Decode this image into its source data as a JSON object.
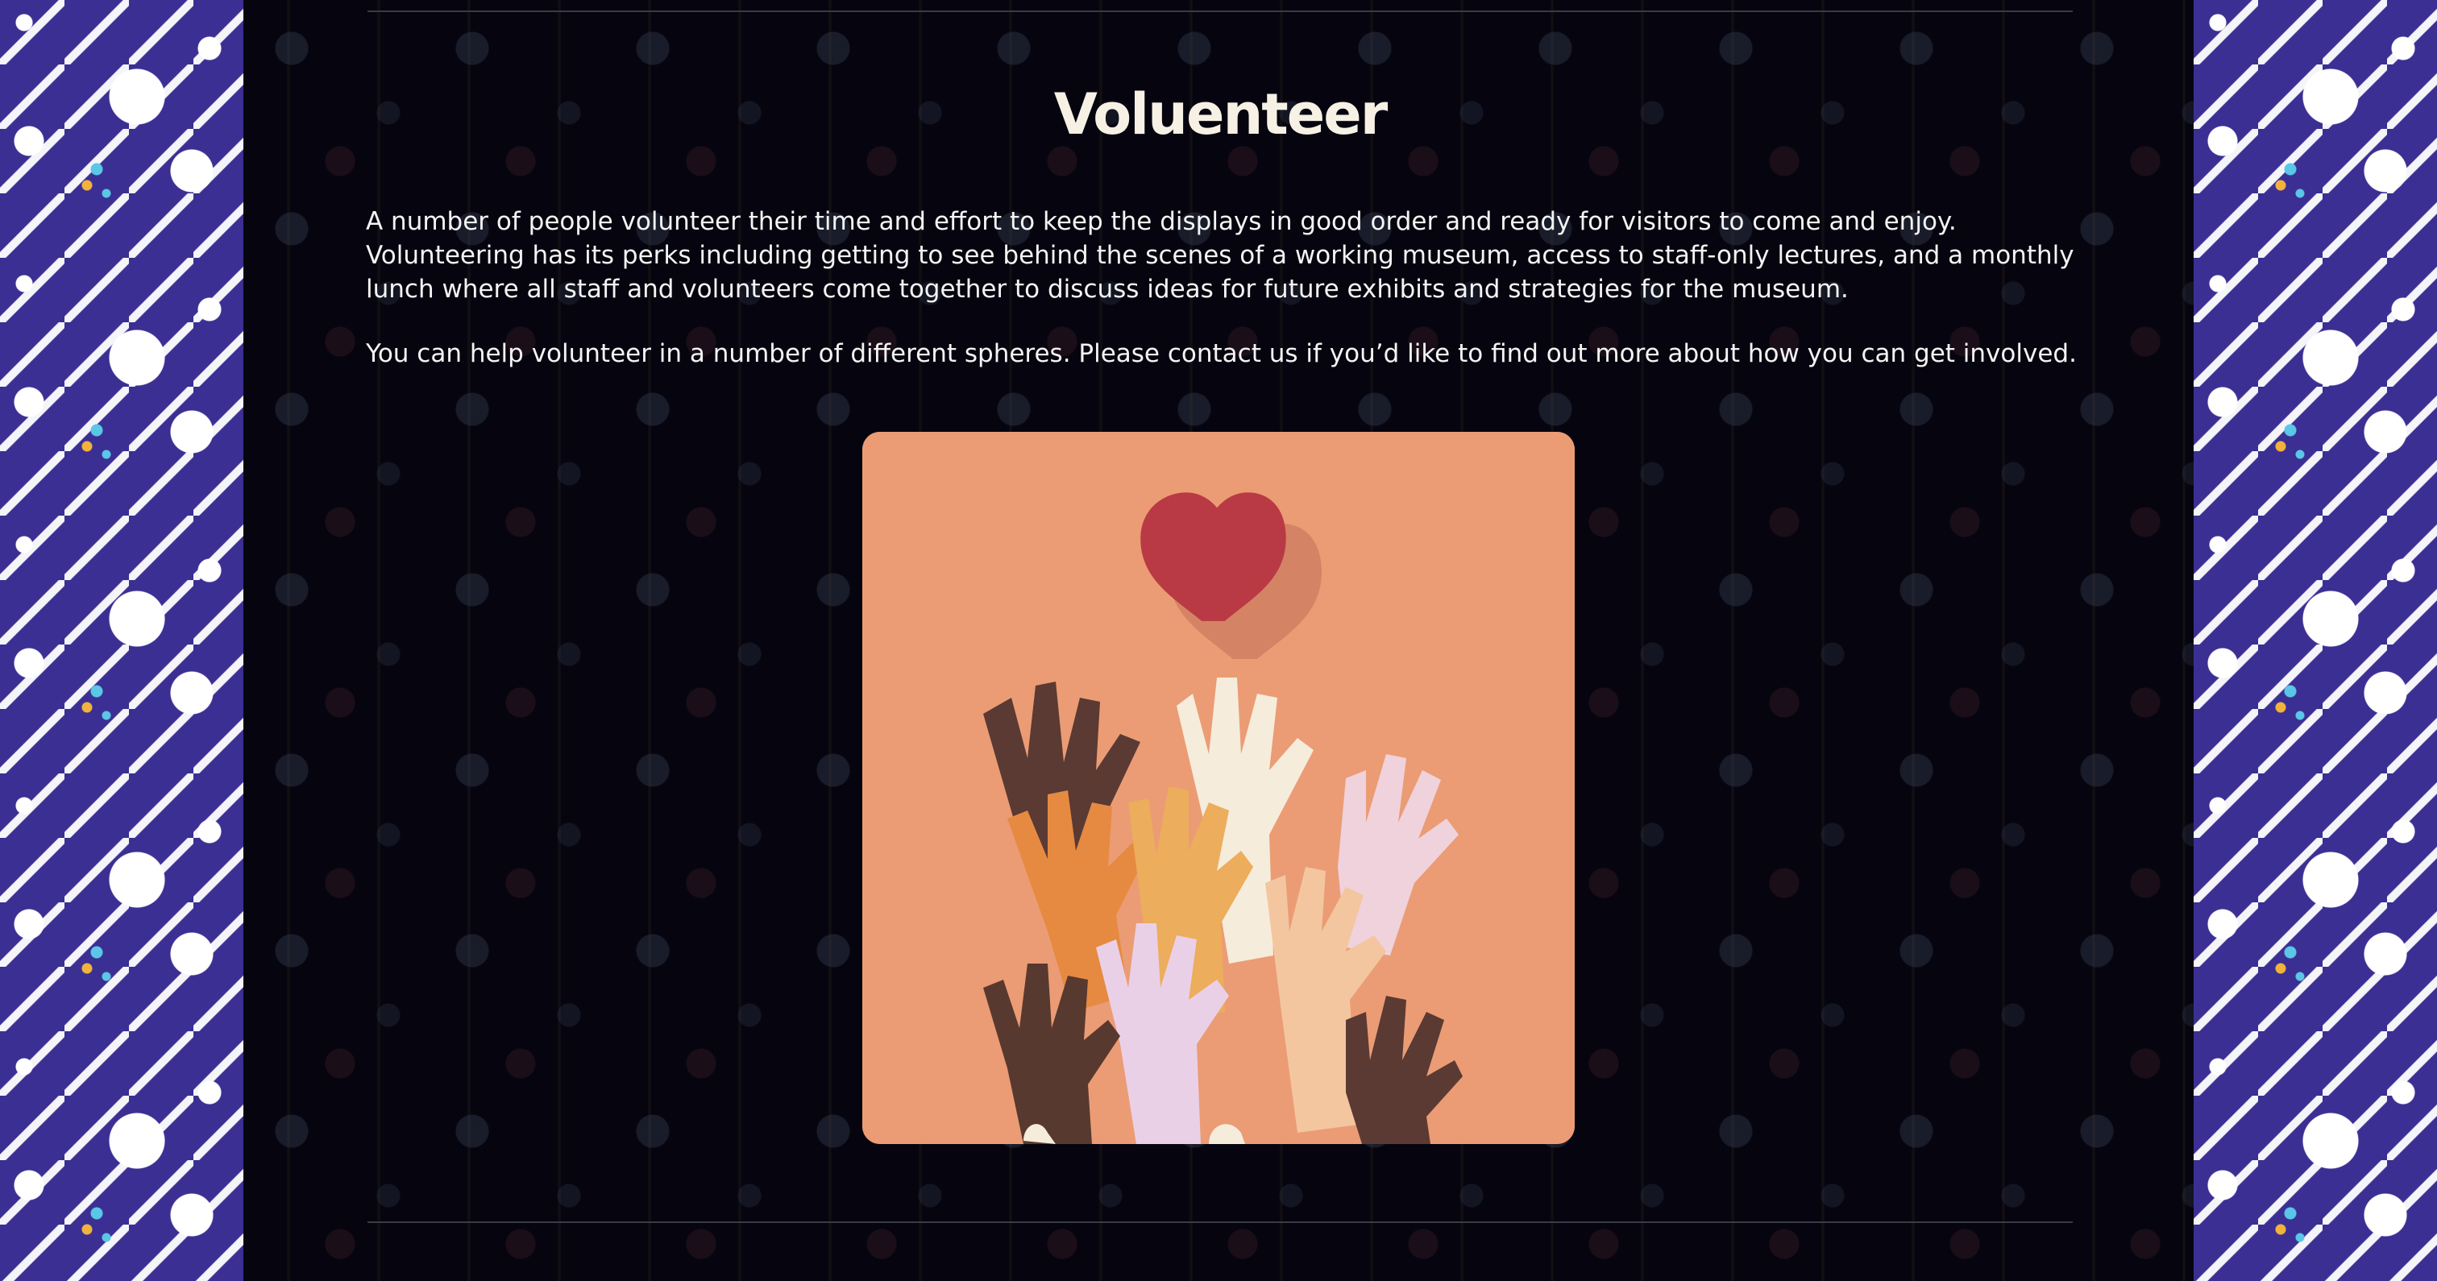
{
  "page": {
    "heading": "Voluenteer",
    "paragraphs": [
      "A number of people volunteer their time and effort to keep the displays in good order and ready for visitors to come and enjoy. Volunteering has its perks including getting to see behind the scenes of a working museum, access to staff-only lectures, and a monthly lunch where all staff and volunteers come together to discuss ideas for future exhibits and strategies for the museum.",
      "You can help volunteer in a number of different spheres. Please contact us if you’d like to find out more about how you can get involved."
    ]
  },
  "illustration": {
    "subject": "paper heart above raised paper hands",
    "colors": {
      "background": "#eb9c74",
      "heart": "#b93a44"
    }
  },
  "theme": {
    "side_pattern": "#3b2f93",
    "panel": "#06050f",
    "text": "#f4f4f4",
    "heading": "#f6f1e4"
  }
}
